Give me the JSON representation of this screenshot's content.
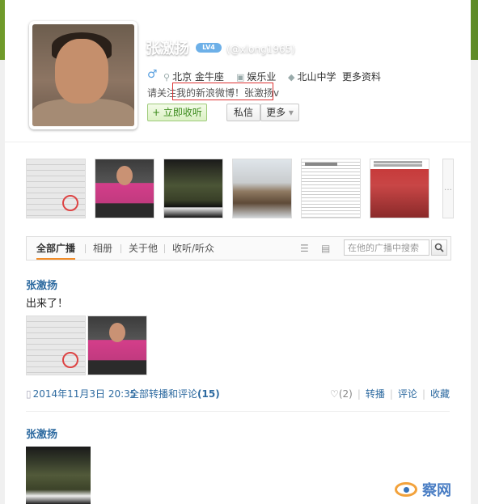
{
  "profile": {
    "name": "张激扬",
    "badge": "LV4",
    "handle": "(@xlong1965)",
    "gender_icon": "♂",
    "location": "北京 金牛座",
    "industry": "娱乐业",
    "school": "北山中学",
    "more_info": "更多资料",
    "bio_prefix": "请关注",
    "bio_highlight": "我的新浪微博！张激扬v",
    "follow_label": "+ 立即收听",
    "message_label": "私信",
    "more_label": "更多",
    "more_caret": "▾"
  },
  "thumbs_more": "…",
  "tabs": {
    "items": [
      "全部广播",
      "相册",
      "关于他",
      "收听/听众"
    ],
    "search_placeholder": "在他的广播中搜索"
  },
  "posts": [
    {
      "author": "张激扬",
      "text": "出来了！",
      "time": "2014年11月3日 20:35",
      "all_forward_label": "全部转播和评论",
      "all_forward_count": "(15)",
      "likes": "(2)",
      "forward": "转播",
      "comment": "评论",
      "favorite": "收藏"
    },
    {
      "author": "张激扬"
    }
  ],
  "watermark": "察网",
  "icons": {
    "location": "location-pin-icon",
    "industry": "briefcase-icon",
    "school": "graduation-cap-icon",
    "clock": "clock-icon",
    "heart": "heart-icon",
    "search": "search-icon"
  },
  "colors": {
    "link": "#2d6aa0",
    "follow_green": "#3a8a1a",
    "tab_accent": "#f28c28",
    "bio_box_border": "#dd3333"
  }
}
